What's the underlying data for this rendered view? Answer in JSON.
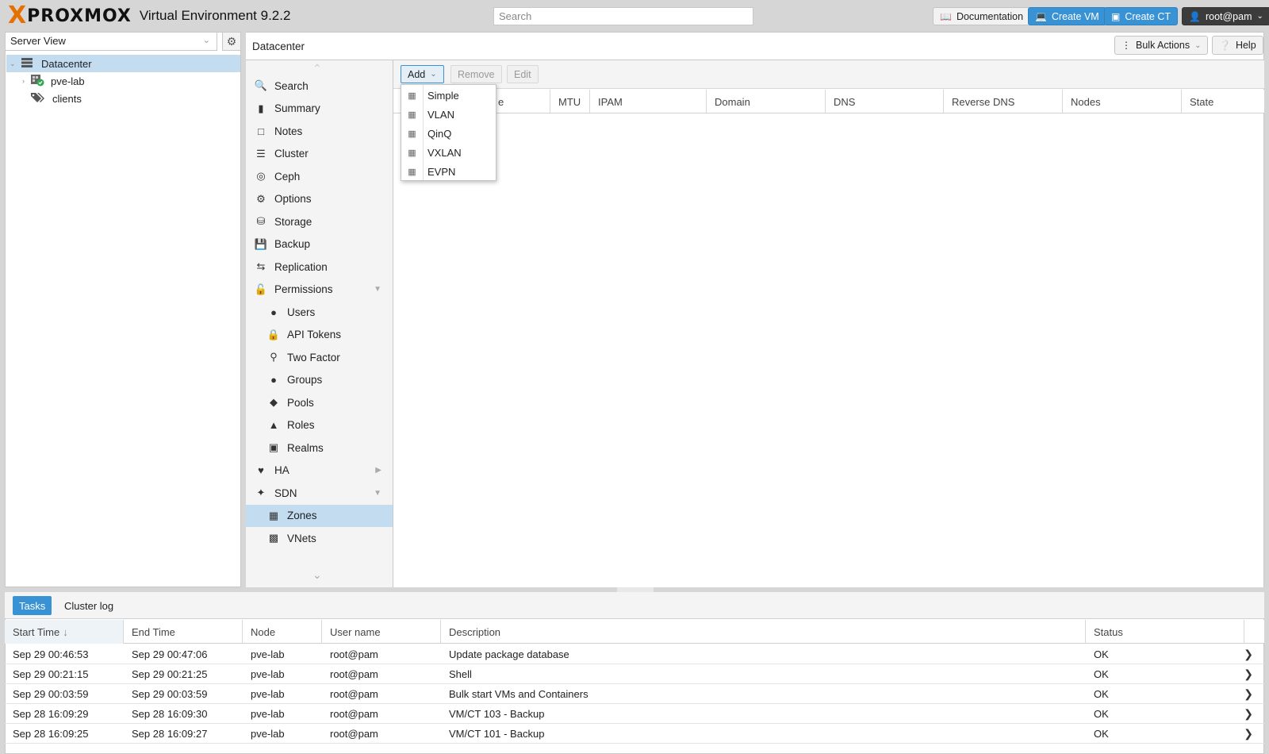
{
  "app": {
    "brand": "PROXMOX",
    "product": "Virtual Environment 9.2.2"
  },
  "header": {
    "search_placeholder": "Search",
    "buttons": {
      "documentation": "Documentation",
      "create_vm": "Create VM",
      "create_ct": "Create CT",
      "user": "root@pam"
    },
    "colors": {
      "accent": "#3892d4",
      "brand_orange": "#e57000",
      "selected": "#c3dcf0"
    }
  },
  "tree": {
    "view": "Server View",
    "items": [
      {
        "label": "Datacenter",
        "icon": "server-rack-icon",
        "selected": true
      },
      {
        "label": "pve-lab",
        "icon": "node-online-icon"
      },
      {
        "label": "clients",
        "icon": "tags-icon"
      }
    ]
  },
  "content": {
    "title": "Datacenter",
    "bulk_actions": "Bulk Actions",
    "help": "Help"
  },
  "nav": [
    {
      "label": "Search",
      "icon": "search-icon"
    },
    {
      "label": "Summary",
      "icon": "book-icon"
    },
    {
      "label": "Notes",
      "icon": "note-icon"
    },
    {
      "label": "Cluster",
      "icon": "server-icon"
    },
    {
      "label": "Ceph",
      "icon": "ceph-icon"
    },
    {
      "label": "Options",
      "icon": "gear-icon"
    },
    {
      "label": "Storage",
      "icon": "database-icon"
    },
    {
      "label": "Backup",
      "icon": "floppy-icon"
    },
    {
      "label": "Replication",
      "icon": "retweet-icon"
    },
    {
      "label": "Permissions",
      "icon": "unlock-icon",
      "expander": "down"
    },
    {
      "label": "Users",
      "icon": "user-icon",
      "sub": true
    },
    {
      "label": "API Tokens",
      "icon": "lock-icon",
      "sub": true
    },
    {
      "label": "Two Factor",
      "icon": "key-icon",
      "sub": true
    },
    {
      "label": "Groups",
      "icon": "users-icon",
      "sub": true
    },
    {
      "label": "Pools",
      "icon": "tags-icon",
      "sub": true
    },
    {
      "label": "Roles",
      "icon": "male-icon",
      "sub": true
    },
    {
      "label": "Realms",
      "icon": "id-badge-icon",
      "sub": true
    },
    {
      "label": "HA",
      "icon": "heartbeat-icon",
      "expander": "right"
    },
    {
      "label": "SDN",
      "icon": "sdn-icon",
      "expander": "down"
    },
    {
      "label": "Zones",
      "icon": "grid-icon",
      "sub": true,
      "selected": true
    },
    {
      "label": "VNets",
      "icon": "sitemap-icon",
      "sub": true
    }
  ],
  "toolbar": {
    "add": "Add",
    "remove": "Remove",
    "edit": "Edit"
  },
  "grid": {
    "columns_visible": [
      "e",
      "MTU",
      "IPAM",
      "Domain",
      "DNS",
      "Reverse DNS",
      "Nodes",
      "State"
    ]
  },
  "add_menu": {
    "items": [
      "Simple",
      "VLAN",
      "QinQ",
      "VXLAN",
      "EVPN"
    ]
  },
  "tasks": {
    "tabs": [
      "Tasks",
      "Cluster log"
    ],
    "columns": [
      "Start Time",
      "End Time",
      "Node",
      "User name",
      "Description",
      "Status"
    ],
    "rows": [
      [
        "Sep 29 00:46:53",
        "Sep 29 00:47:06",
        "pve-lab",
        "root@pam",
        "Update package database",
        "OK"
      ],
      [
        "Sep 29 00:21:15",
        "Sep 29 00:21:25",
        "pve-lab",
        "root@pam",
        "Shell",
        "OK"
      ],
      [
        "Sep 29 00:03:59",
        "Sep 29 00:03:59",
        "pve-lab",
        "root@pam",
        "Bulk start VMs and Containers",
        "OK"
      ],
      [
        "Sep 28 16:09:29",
        "Sep 28 16:09:30",
        "pve-lab",
        "root@pam",
        "VM/CT 103 - Backup",
        "OK"
      ],
      [
        "Sep 28 16:09:25",
        "Sep 28 16:09:27",
        "pve-lab",
        "root@pam",
        "VM/CT 101 - Backup",
        "OK"
      ]
    ]
  }
}
